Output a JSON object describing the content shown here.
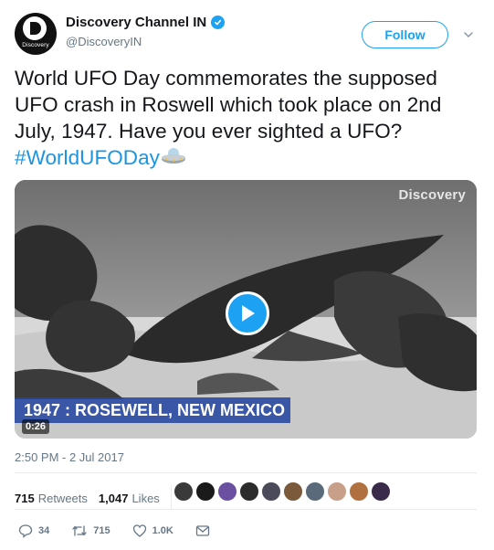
{
  "author": {
    "display_name": "Discovery Channel IN",
    "handle": "@DiscoveryIN",
    "avatar_text": "Discovery",
    "verified_icon": "verified-badge-icon"
  },
  "header": {
    "follow_label": "Follow",
    "caret_icon": "chevron-down-icon"
  },
  "tweet": {
    "text_part1": "World UFO Day commemorates the supposed UFO crash in Roswell which took place on 2nd July, 1947. Have you ever sighted a UFO? ",
    "hashtag": "#WorldUFODay",
    "emoji": "ufo-emoji"
  },
  "video": {
    "watermark": "Discovery",
    "caption": "1947 : ROSEWELL, NEW MEXICO",
    "duration": "0:26",
    "play_icon": "play-icon"
  },
  "meta": {
    "timestamp": "2:50 PM - 2 Jul 2017",
    "retweets_count": "715",
    "retweets_label": "Retweets",
    "likes_count": "1,047",
    "likes_label": "Likes",
    "liker_count": 10
  },
  "actions": {
    "reply_count": "34",
    "retweet_count": "715",
    "like_count": "1.0K"
  },
  "colors": {
    "accent": "#1da1f2",
    "hashtag": "#1b95e0",
    "muted": "#657786"
  }
}
